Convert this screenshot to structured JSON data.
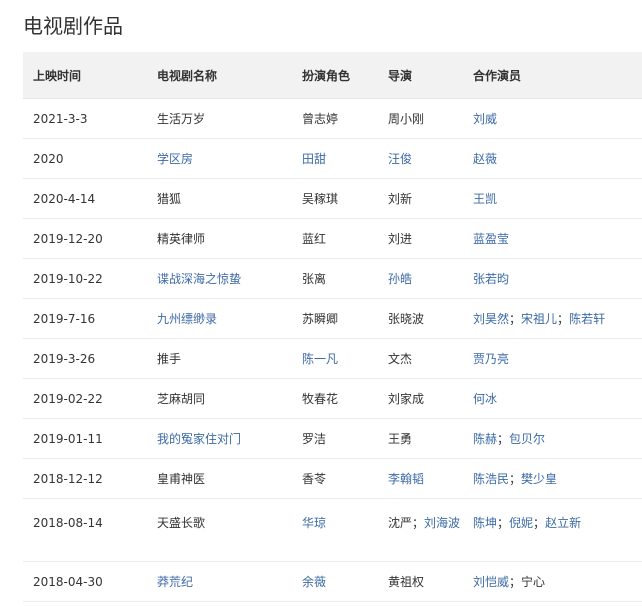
{
  "page": {
    "title": "电视剧作品"
  },
  "table": {
    "headers": [
      "上映时间",
      "电视剧名称",
      "扮演角色",
      "导演",
      "合作演员"
    ],
    "rows": [
      {
        "date": "2021-3-3",
        "title": {
          "text": "生活万岁",
          "link": false
        },
        "role": {
          "text": "曾志婷",
          "link": false
        },
        "director": [
          {
            "text": "周小刚",
            "link": false
          }
        ],
        "costars": [
          {
            "text": "刘威",
            "link": true
          }
        ]
      },
      {
        "date": "2020",
        "title": {
          "text": "学区房",
          "link": true
        },
        "role": {
          "text": "田甜",
          "link": true
        },
        "director": [
          {
            "text": "汪俊",
            "link": true
          }
        ],
        "costars": [
          {
            "text": "赵薇",
            "link": true
          }
        ]
      },
      {
        "date": "2020-4-14",
        "title": {
          "text": "猎狐",
          "link": false
        },
        "role": {
          "text": "吴稼琪",
          "link": false
        },
        "director": [
          {
            "text": "刘新",
            "link": false
          }
        ],
        "costars": [
          {
            "text": "王凯",
            "link": true
          }
        ]
      },
      {
        "date": "2019-12-20",
        "title": {
          "text": "精英律师",
          "link": false
        },
        "role": {
          "text": "蓝红",
          "link": false
        },
        "director": [
          {
            "text": "刘进",
            "link": false
          }
        ],
        "costars": [
          {
            "text": "蓝盈莹",
            "link": true
          }
        ]
      },
      {
        "date": "2019-10-22",
        "title": {
          "text": "谍战深海之惊蛰",
          "link": true
        },
        "role": {
          "text": "张离",
          "link": false
        },
        "director": [
          {
            "text": "孙皓",
            "link": true
          }
        ],
        "costars": [
          {
            "text": "张若昀",
            "link": true
          }
        ]
      },
      {
        "date": "2019-7-16",
        "title": {
          "text": "九州缥缈录",
          "link": true
        },
        "role": {
          "text": "苏瞬卿",
          "link": false
        },
        "director": [
          {
            "text": "张晓波",
            "link": false
          }
        ],
        "costars": [
          {
            "text": "刘昊然",
            "link": true
          },
          {
            "text": "宋祖儿",
            "link": true
          },
          {
            "text": "陈若轩",
            "link": true
          }
        ]
      },
      {
        "date": "2019-3-26",
        "title": {
          "text": "推手",
          "link": false
        },
        "role": {
          "text": "陈一凡",
          "link": true
        },
        "director": [
          {
            "text": "文杰",
            "link": false
          }
        ],
        "costars": [
          {
            "text": "贾乃亮",
            "link": true
          }
        ]
      },
      {
        "date": "2019-02-22",
        "title": {
          "text": "芝麻胡同",
          "link": false
        },
        "role": {
          "text": "牧春花",
          "link": false
        },
        "director": [
          {
            "text": "刘家成",
            "link": false
          }
        ],
        "costars": [
          {
            "text": "何冰",
            "link": true
          }
        ]
      },
      {
        "date": "2019-01-11",
        "title": {
          "text": "我的冤家住对门",
          "link": true
        },
        "role": {
          "text": "罗洁",
          "link": false
        },
        "director": [
          {
            "text": "王勇",
            "link": false
          }
        ],
        "costars": [
          {
            "text": "陈赫",
            "link": true
          },
          {
            "text": "包贝尔",
            "link": true
          }
        ]
      },
      {
        "date": "2018-12-12",
        "title": {
          "text": "皇甫神医",
          "link": false
        },
        "role": {
          "text": "香苓",
          "link": false
        },
        "director": [
          {
            "text": "李翰韬",
            "link": true
          }
        ],
        "costars": [
          {
            "text": "陈浩民",
            "link": true
          },
          {
            "text": "樊少皇",
            "link": true
          }
        ]
      },
      {
        "date": "2018-08-14",
        "title": {
          "text": "天盛长歌",
          "link": false
        },
        "role": {
          "text": "华琼",
          "link": true
        },
        "director": [
          {
            "text": "沈严",
            "link": false
          },
          {
            "text": "刘海波",
            "link": true
          }
        ],
        "costars": [
          {
            "text": "陈坤",
            "link": true
          },
          {
            "text": "倪妮",
            "link": true
          },
          {
            "text": "赵立新",
            "link": true
          }
        ]
      },
      {
        "date": "2018-04-30",
        "title": {
          "text": "莽荒纪",
          "link": true
        },
        "role": {
          "text": "余薇",
          "link": true
        },
        "director": [
          {
            "text": "黄祖权",
            "link": false
          }
        ],
        "costars": [
          {
            "text": "刘恺威",
            "link": true
          },
          {
            "text": "宁心",
            "link": false
          }
        ]
      }
    ]
  },
  "separator": "；",
  "colors": {
    "link": "#3c6aa6",
    "text": "#333333",
    "header_bg": "#f2f2f2"
  }
}
